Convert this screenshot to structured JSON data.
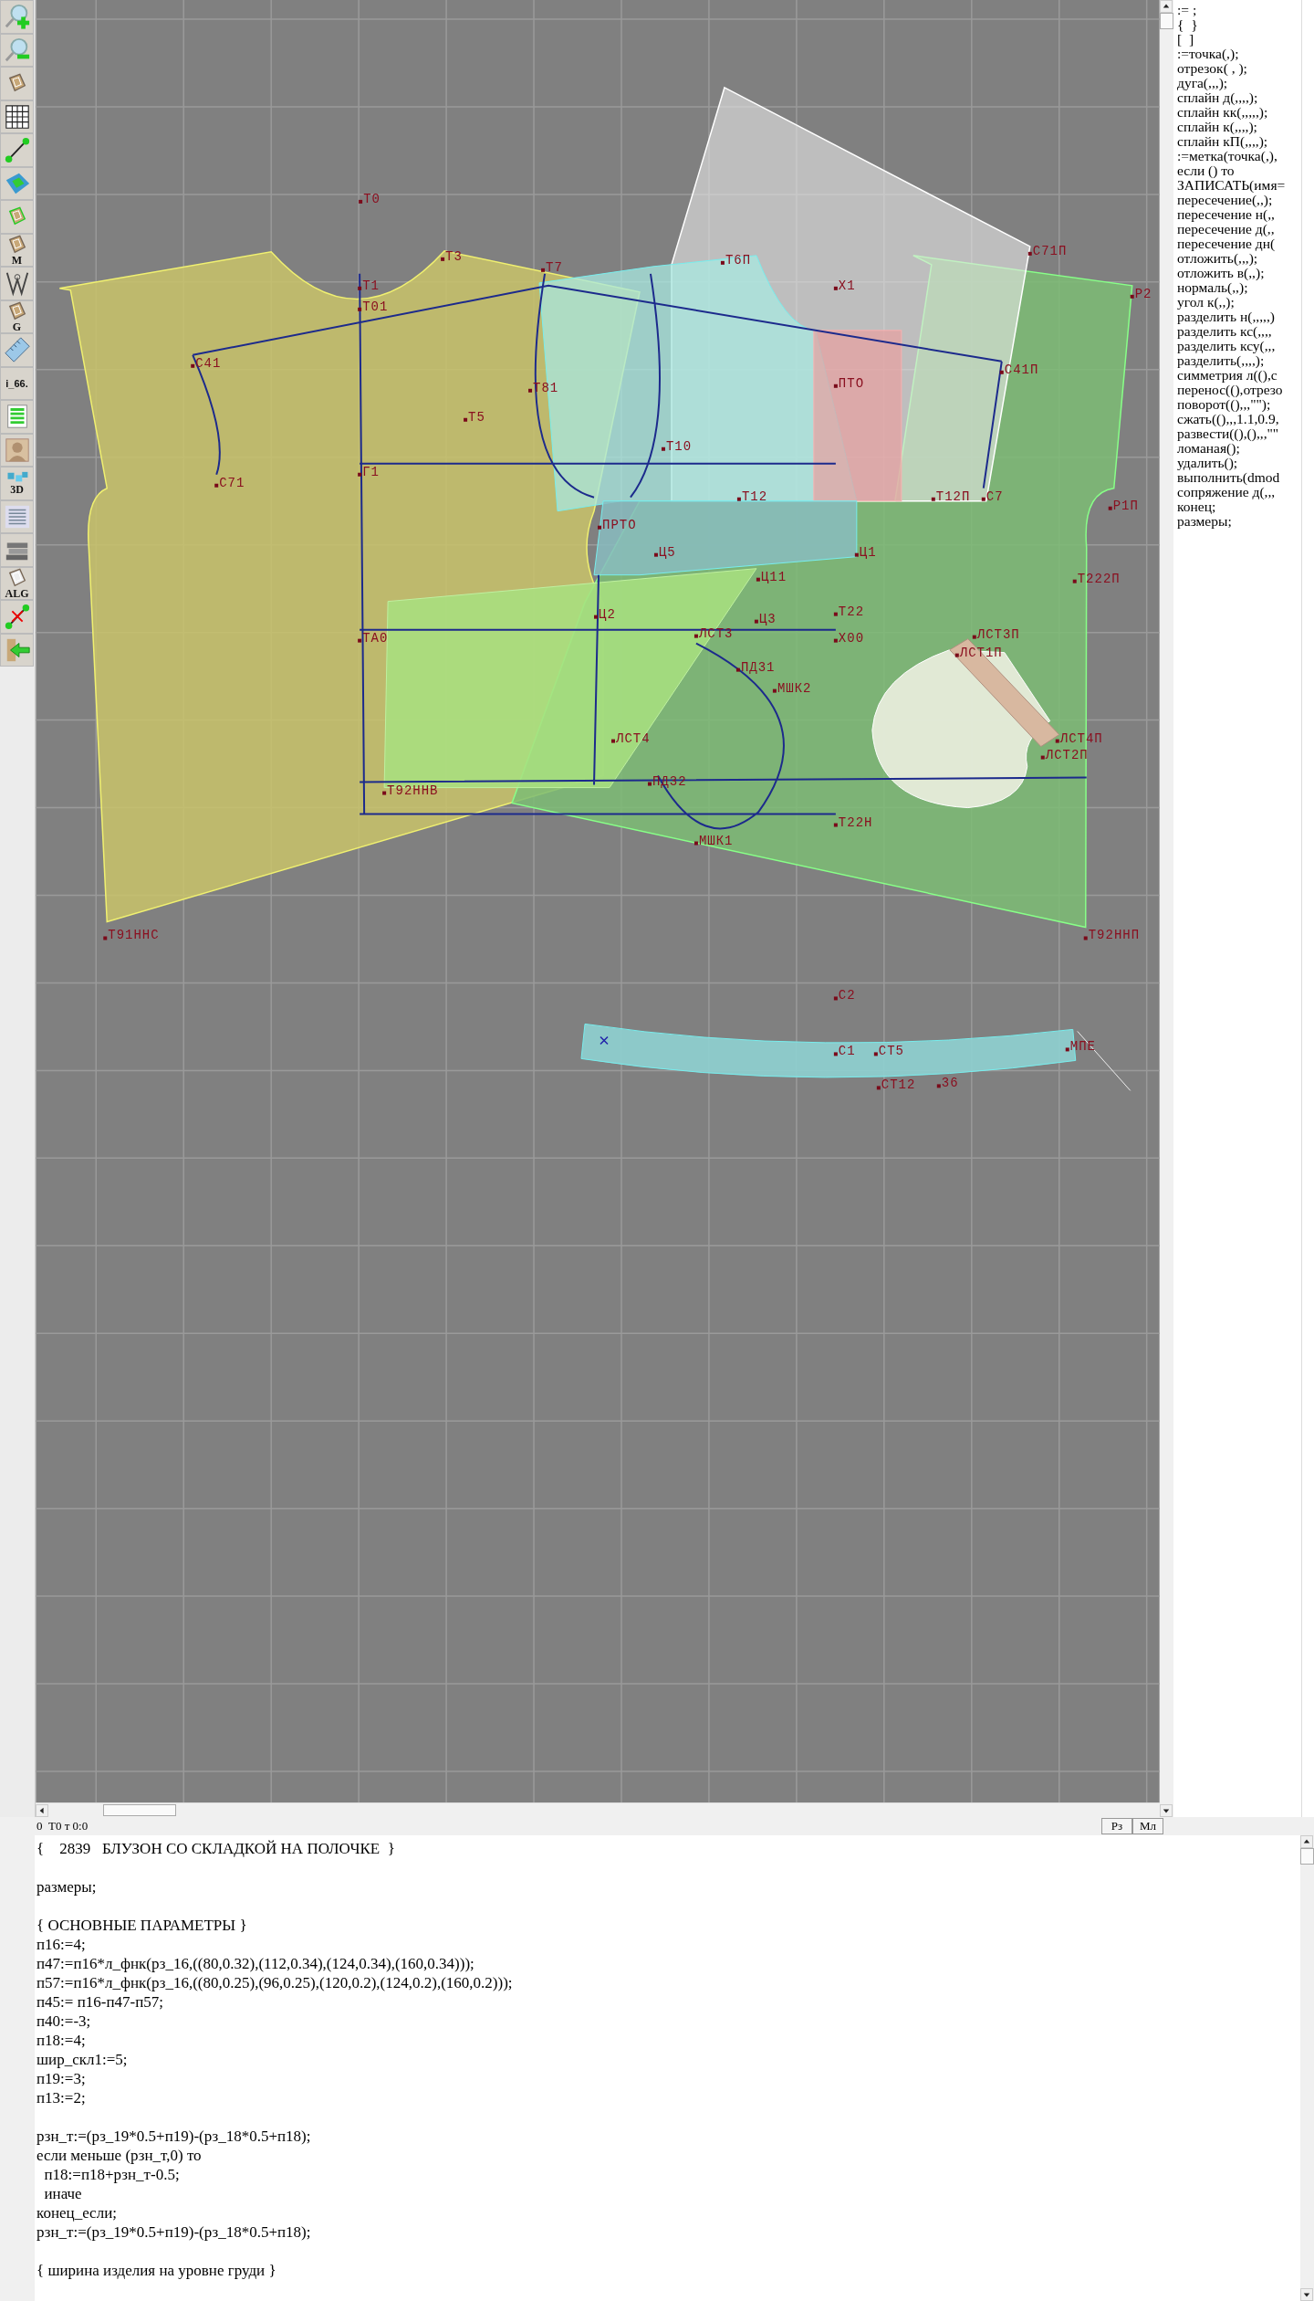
{
  "toolbar": [
    {
      "kind": "zoom-in"
    },
    {
      "kind": "zoom-out"
    },
    {
      "kind": "pattern"
    },
    {
      "kind": "grid"
    },
    {
      "kind": "segment"
    },
    {
      "kind": "layer"
    },
    {
      "kind": "outline"
    },
    {
      "kind": "letter",
      "label": "M"
    },
    {
      "kind": "compass"
    },
    {
      "kind": "letter",
      "label": "G"
    },
    {
      "kind": "ruler"
    },
    {
      "kind": "text",
      "label": "i_66."
    },
    {
      "kind": "table"
    },
    {
      "kind": "portrait"
    },
    {
      "kind": "badge",
      "label": "3D"
    },
    {
      "kind": "list"
    },
    {
      "kind": "books"
    },
    {
      "kind": "doc",
      "label": "ALG"
    },
    {
      "kind": "cut"
    },
    {
      "kind": "exit"
    }
  ],
  "canvas": {
    "labels": [
      "Т0",
      "Т3",
      "Т7",
      "Т1",
      "Т01",
      "С41",
      "С71",
      "Т5",
      "Т81",
      "Г1",
      "С71П",
      "Х1",
      "Т6П",
      "ПТО",
      "Т10",
      "С41П",
      "Т12",
      "Т12П",
      "С7",
      "Р1П",
      "Р2",
      "ПРТО",
      "Ц5",
      "Ц1",
      "Ц11",
      "Т222П",
      "Ц2",
      "Ц3",
      "Т22",
      "ТА0",
      "Х00",
      "ЛСТ3",
      "ПД31",
      "МШК2",
      "ЛСТ3П",
      "ЛСТ1П",
      "ЛСТ4П",
      "ЛСТ2П",
      "ЛСТ4",
      "ПД32",
      "Т92ННВ",
      "МШК1",
      "Т22Н",
      "Т91ННС",
      "Т92ННП",
      "С2",
      "С1",
      "СТ5",
      "СТ12",
      "36",
      "МПЕ"
    ]
  },
  "status_bar": {
    "position": "0  Т0 т 0:0",
    "buttons": [
      {
        "label": "Рз"
      },
      {
        "label": "Мл"
      }
    ]
  },
  "command_list": [
    ":= ;",
    "{  }",
    "[  ]",
    ":=точка(,);",
    "отрезок( , );",
    "дуга(,,,);",
    "сплайн д(,,,,);",
    "сплайн кк(,,,,,);",
    "сплайн к(,,,,);",
    "сплайн кП(,,,,);",
    ":=метка(точка(,),",
    "если () то",
    "ЗАПИСАТЬ(имя=",
    "пересечение(,,);",
    "пересечение н(,,",
    "пересечение д(,,",
    "пересечение дн(",
    "отложить(,,,);",
    "отложить в(,,);",
    "нормаль(,,);",
    "угол к(,,);",
    "разделить н(,,,,,)",
    "разделить кс(,,,,",
    "разделить ксу(,,,",
    "разделить(,,,,);",
    "симметрия л((),с",
    "перенос((),отрезо",
    "поворот((),,,\"\");",
    "сжать((),,,1.1,0.9,",
    "развести((),(),,,\"\"",
    "ломаная();",
    "удалить();",
    "выполнить(dmod",
    "сопряжение д(,,,",
    "конец;",
    "размеры;"
  ],
  "editor": {
    "blocks": [
      {
        "lines": [
          "{    2839   БЛУЗОН СО СКЛАДКОЙ НА ПОЛОЧКЕ  }"
        ]
      },
      {
        "lines": [
          "размеры;"
        ]
      },
      {
        "lines": [
          "{ ОСНОВНЫЕ ПАРАМЕТРЫ }",
          "п16:=4;",
          "п47:=п16*л_фнк(рз_16,((80,0.32),(112,0.34),(124,0.34),(160,0.34)));",
          "п57:=п16*л_фнк(рз_16,((80,0.25),(96,0.25),(120,0.2),(124,0.2),(160,0.2)));",
          "п45:= п16-п47-п57;",
          "п40:=-3;",
          "п18:=4;",
          "шир_скл1:=5;",
          "п19:=3;",
          "п13:=2;"
        ]
      },
      {
        "lines": [
          "рзн_т:=(рз_19*0.5+п19)-(рз_18*0.5+п18);",
          "если меньше (рзн_т,0) то",
          "  п18:=п18+рзн_т-0.5;",
          "  иначе",
          "конец_если;",
          "рзн_т:=(рз_19*0.5+п19)-(рз_18*0.5+п18);"
        ]
      },
      {
        "lines": [
          "{ ширина изделия на уровне груди }"
        ]
      }
    ]
  }
}
